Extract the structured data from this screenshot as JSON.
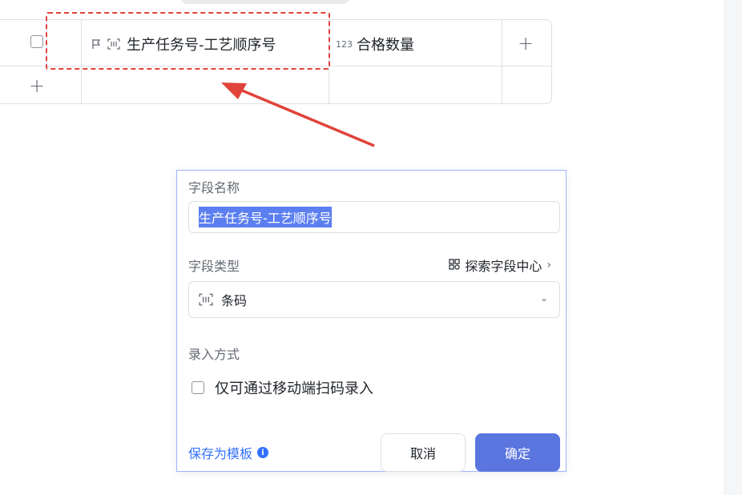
{
  "table": {
    "col1_label": "生产任务号-工艺顺序号",
    "col2_type_badge": "123",
    "col2_label": "合格数量",
    "add_column_symbol": "+",
    "add_row_symbol": "+"
  },
  "dialog": {
    "field_name_label": "字段名称",
    "field_name_value": "生产任务号-工艺顺序号",
    "field_type_label": "字段类型",
    "explore_label": "探索字段中心",
    "field_type_value": "条码",
    "input_method_label": "录入方式",
    "mobile_scan_only_label": "仅可通过移动端扫码录入",
    "save_template_label": "保存为模板",
    "cancel_label": "取消",
    "ok_label": "确定"
  },
  "colors": {
    "accent": "#3370ff",
    "primary_button": "#5b75df",
    "annotation": "#e0433a",
    "selection": "#5b7ff0"
  },
  "icons": [
    "flag-icon",
    "barcode-icon",
    "number-type-icon",
    "plus-icon",
    "grid-icon",
    "chevron-right-icon",
    "chevron-down-icon",
    "info-icon"
  ]
}
